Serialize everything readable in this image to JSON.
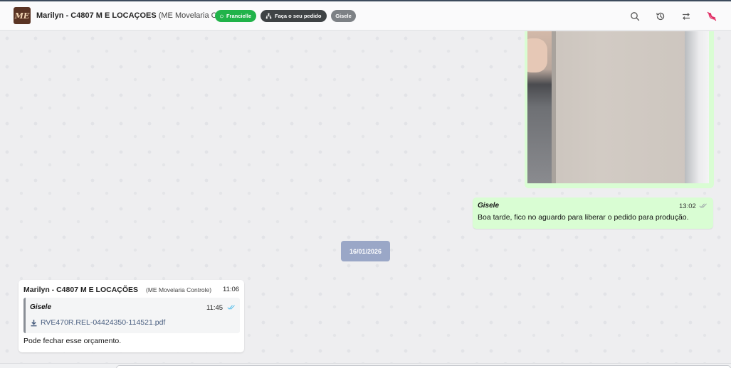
{
  "header": {
    "logo_text": "ME",
    "contact_name": "Marilyn - C4807 M E LOCAÇOES",
    "contact_org": "(ME Movelaria Controle)",
    "chips": {
      "agent": "Francielle",
      "order": "Faça o seu pedido",
      "user": "Gisele"
    },
    "icons": [
      "search-icon",
      "history-icon",
      "transfer-icon",
      "end-call-icon"
    ]
  },
  "messages": {
    "outgoing": {
      "sender": "Gisele",
      "time": "13:02",
      "text": "Boa tarde, fico no aguardo para liberar o pedido para produção."
    },
    "date_separator": "16/01/2026",
    "incoming": {
      "sender": "Marilyn - C4807 M E LOCAÇÕES",
      "sender_org": "(ME Movelaria Controle)",
      "time": "11:06",
      "quoted": {
        "sender": "Gisele",
        "time": "11:45",
        "file_name": "RVE470R.REL-04424350-114521.pdf"
      },
      "text": "Pode fechar esse orçamento."
    }
  },
  "colors": {
    "outgoing_bubble": "#d9fdd3",
    "incoming_bubble": "#ffffff",
    "whatsapp_green": "#21b34a",
    "date_pill": "#9aa7c7",
    "end_call_red": "#e0245e"
  }
}
